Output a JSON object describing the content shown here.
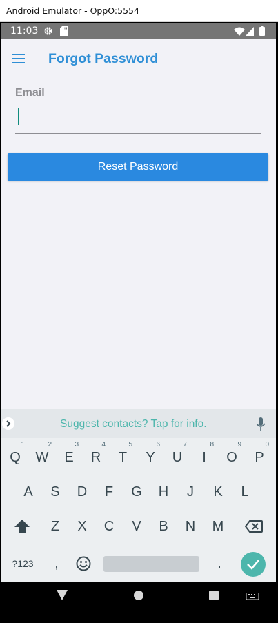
{
  "window": {
    "title": "Android Emulator - OppO:5554"
  },
  "status_bar": {
    "time": "11:03",
    "icons": [
      "gear-icon",
      "sd-card-icon",
      "wifi-icon",
      "signal-icon",
      "battery-icon"
    ]
  },
  "app_bar": {
    "title": "Forgot Password",
    "menu_icon": "hamburger-menu-icon"
  },
  "form": {
    "email_label": "Email",
    "email_value": "",
    "reset_button_label": "Reset Password"
  },
  "keyboard": {
    "suggestion": "Suggest contacts? Tap for info.",
    "row1": [
      {
        "label": "Q",
        "hint": "1"
      },
      {
        "label": "W",
        "hint": "2"
      },
      {
        "label": "E",
        "hint": "3"
      },
      {
        "label": "R",
        "hint": "4"
      },
      {
        "label": "T",
        "hint": "5"
      },
      {
        "label": "Y",
        "hint": "6"
      },
      {
        "label": "U",
        "hint": "7"
      },
      {
        "label": "I",
        "hint": "8"
      },
      {
        "label": "O",
        "hint": "9"
      },
      {
        "label": "P",
        "hint": "0"
      }
    ],
    "row2": [
      "A",
      "S",
      "D",
      "F",
      "G",
      "H",
      "J",
      "K",
      "L"
    ],
    "row3": [
      "Z",
      "X",
      "C",
      "V",
      "B",
      "N",
      "M"
    ],
    "symbols_label": "?123",
    "comma_label": ",",
    "period_label": "."
  },
  "colors": {
    "accent": "#2f8fd6",
    "button": "#2a89e0",
    "keyboard_accent": "#4db6ac"
  }
}
